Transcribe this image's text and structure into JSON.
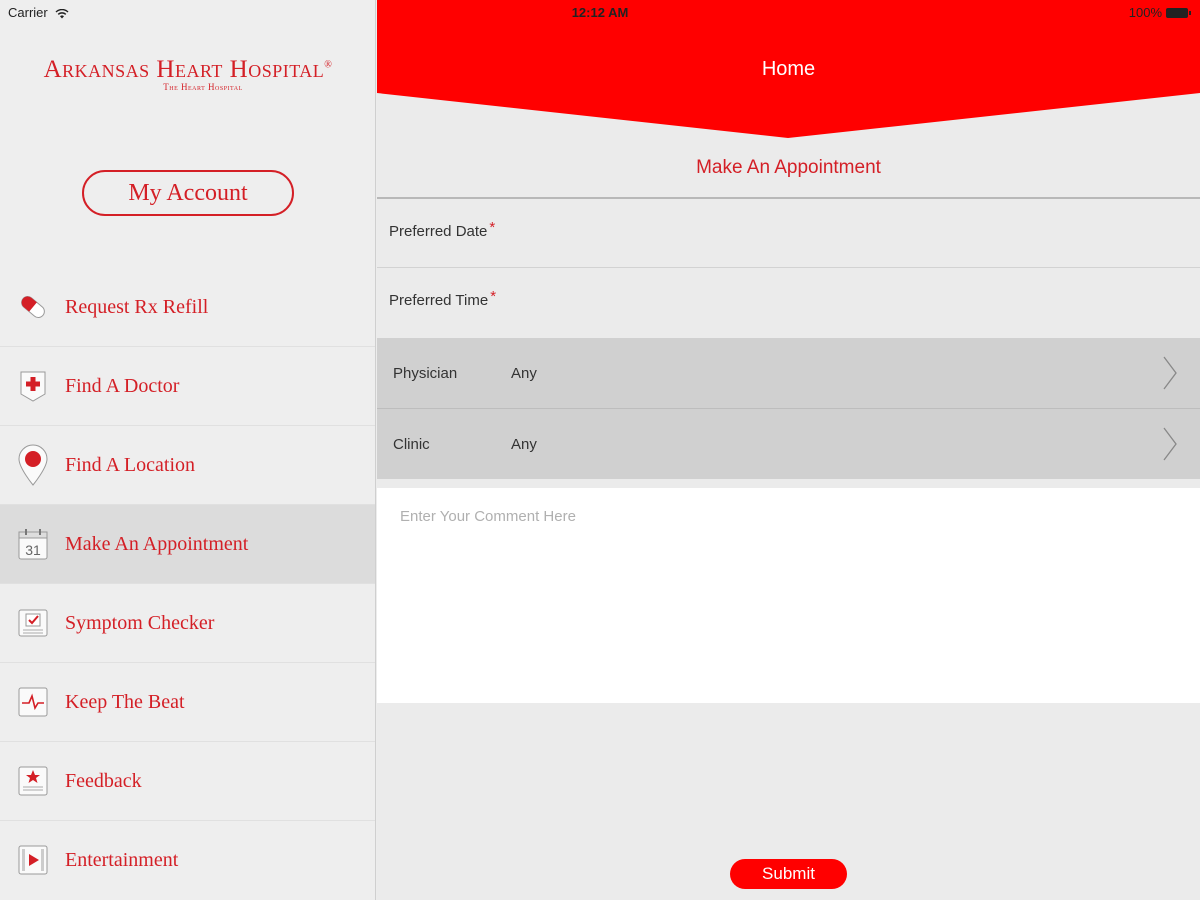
{
  "status_bar": {
    "carrier": "Carrier",
    "time": "12:12 AM",
    "battery": "100%"
  },
  "sidebar": {
    "logo_main": "Arkansas Heart Hospital",
    "logo_registered": "®",
    "logo_sub": "The Heart Hospital",
    "account_button": "My Account",
    "items": [
      {
        "label": "Request Rx Refill",
        "icon": "pill-icon"
      },
      {
        "label": "Find A Doctor",
        "icon": "medical-cross-icon"
      },
      {
        "label": "Find A Location",
        "icon": "location-pin-icon"
      },
      {
        "label": "Make An Appointment",
        "icon": "calendar-icon",
        "calendar_day": "31"
      },
      {
        "label": "Symptom Checker",
        "icon": "checklist-icon"
      },
      {
        "label": "Keep The Beat",
        "icon": "heartbeat-icon"
      },
      {
        "label": "Feedback",
        "icon": "feedback-star-icon"
      },
      {
        "label": "Entertainment",
        "icon": "video-play-icon"
      }
    ],
    "active_index": 3
  },
  "main": {
    "header_title": "Home",
    "subtitle": "Make An Appointment",
    "preferred_date_label": "Preferred Date",
    "preferred_time_label": "Preferred Time",
    "required_marker": "*",
    "physician_label": "Physician",
    "physician_value": "Any",
    "clinic_label": "Clinic",
    "clinic_value": "Any",
    "comment_placeholder": "Enter Your Comment Here",
    "submit_label": "Submit"
  },
  "colors": {
    "brand_red": "#d41f26",
    "header_red": "#ff0000",
    "selected_row": "#d0d0d0"
  }
}
